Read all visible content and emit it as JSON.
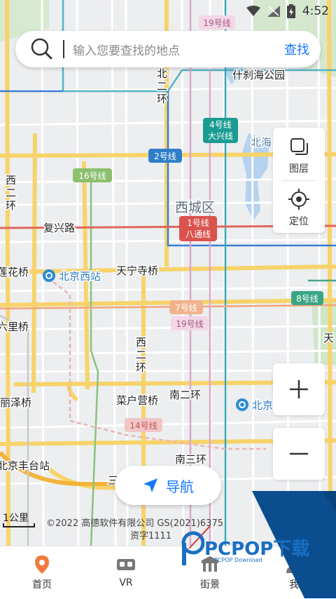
{
  "status_bar": {
    "time": "4:52"
  },
  "search": {
    "placeholder": "输入您要查找的地点",
    "button": "查找"
  },
  "map_labels": {
    "line_19": "19号线",
    "shichahai": "什刹海公园",
    "beierhuan": [
      "北",
      "二",
      "环"
    ],
    "line_4": "4号线",
    "daxing": "大兴线",
    "beihai": "北海",
    "line_2": "2号线",
    "line_16": "16号线",
    "xierhuan_a": [
      "西",
      "二",
      "环"
    ],
    "xicheng": "西城区",
    "line_1": "1号线",
    "batong": "八通线",
    "fuxinglu": "复兴路",
    "lianhuaqiao": "莲花桥",
    "beijingxizhan": "北京西站",
    "tianningsi": "天宁寺桥",
    "line_7": "7号线",
    "line_8": "8号线",
    "line_19b": "19号线",
    "liuliqiao": "六里桥",
    "xierhuan_b": [
      "西",
      "二",
      "环"
    ],
    "tian": "天",
    "lizeqiao": "丽泽桥",
    "caihuying": "菜户营桥",
    "nanerhuan": "南二环",
    "beijing": "北京",
    "line_14": "14号线",
    "fengtaizhan": "北京丰台站",
    "nansanhuan": "南三环",
    "san": "三"
  },
  "map_controls": {
    "layers": "图层",
    "locate": "定位",
    "zoom_in": "+",
    "zoom_out": "−"
  },
  "navigate_button": "导航",
  "scale": "1公里",
  "copyright": [
    "©2022 高德软件有限公司 GS(2021)6375",
    "资字1111"
  ],
  "tabs": [
    {
      "label": "首页",
      "icon": "location-pin-icon"
    },
    {
      "label": "VR",
      "icon": "vr-headset-icon"
    },
    {
      "label": "街景",
      "icon": "street-view-icon"
    },
    {
      "label": "我",
      "icon": "profile-icon"
    }
  ],
  "watermark": {
    "brand": "PCPOP下载",
    "sub": "PCPOP Download"
  }
}
